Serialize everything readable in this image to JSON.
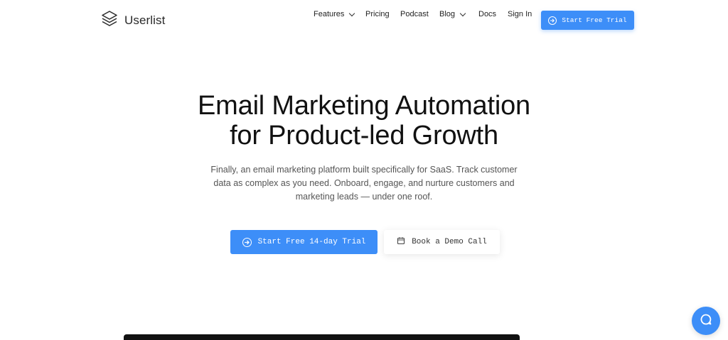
{
  "brand": {
    "name": "Userlist"
  },
  "nav": {
    "features": "Features",
    "pricing": "Pricing",
    "podcast": "Podcast",
    "blog": "Blog",
    "docs": "Docs",
    "signin": "Sign In"
  },
  "header_cta": "Start Free Trial",
  "hero": {
    "title_line1": "Email Marketing Automation",
    "title_line2": "for Product-led Growth",
    "subtitle": "Finally, an email marketing platform built specifically for SaaS. Track customer data as complex as you need. Onboard, engage, and nurture customers and marketing leads — under one roof."
  },
  "cta": {
    "primary": "Start Free 14-day Trial",
    "secondary": "Book a Demo Call"
  },
  "colors": {
    "accent": "#3d8ef8",
    "text": "#111111",
    "muted": "#555555"
  },
  "icons": [
    "stack-logo-icon",
    "chevron-down-icon",
    "circle-arrow-right-icon",
    "calendar-icon",
    "chat-icon"
  ]
}
